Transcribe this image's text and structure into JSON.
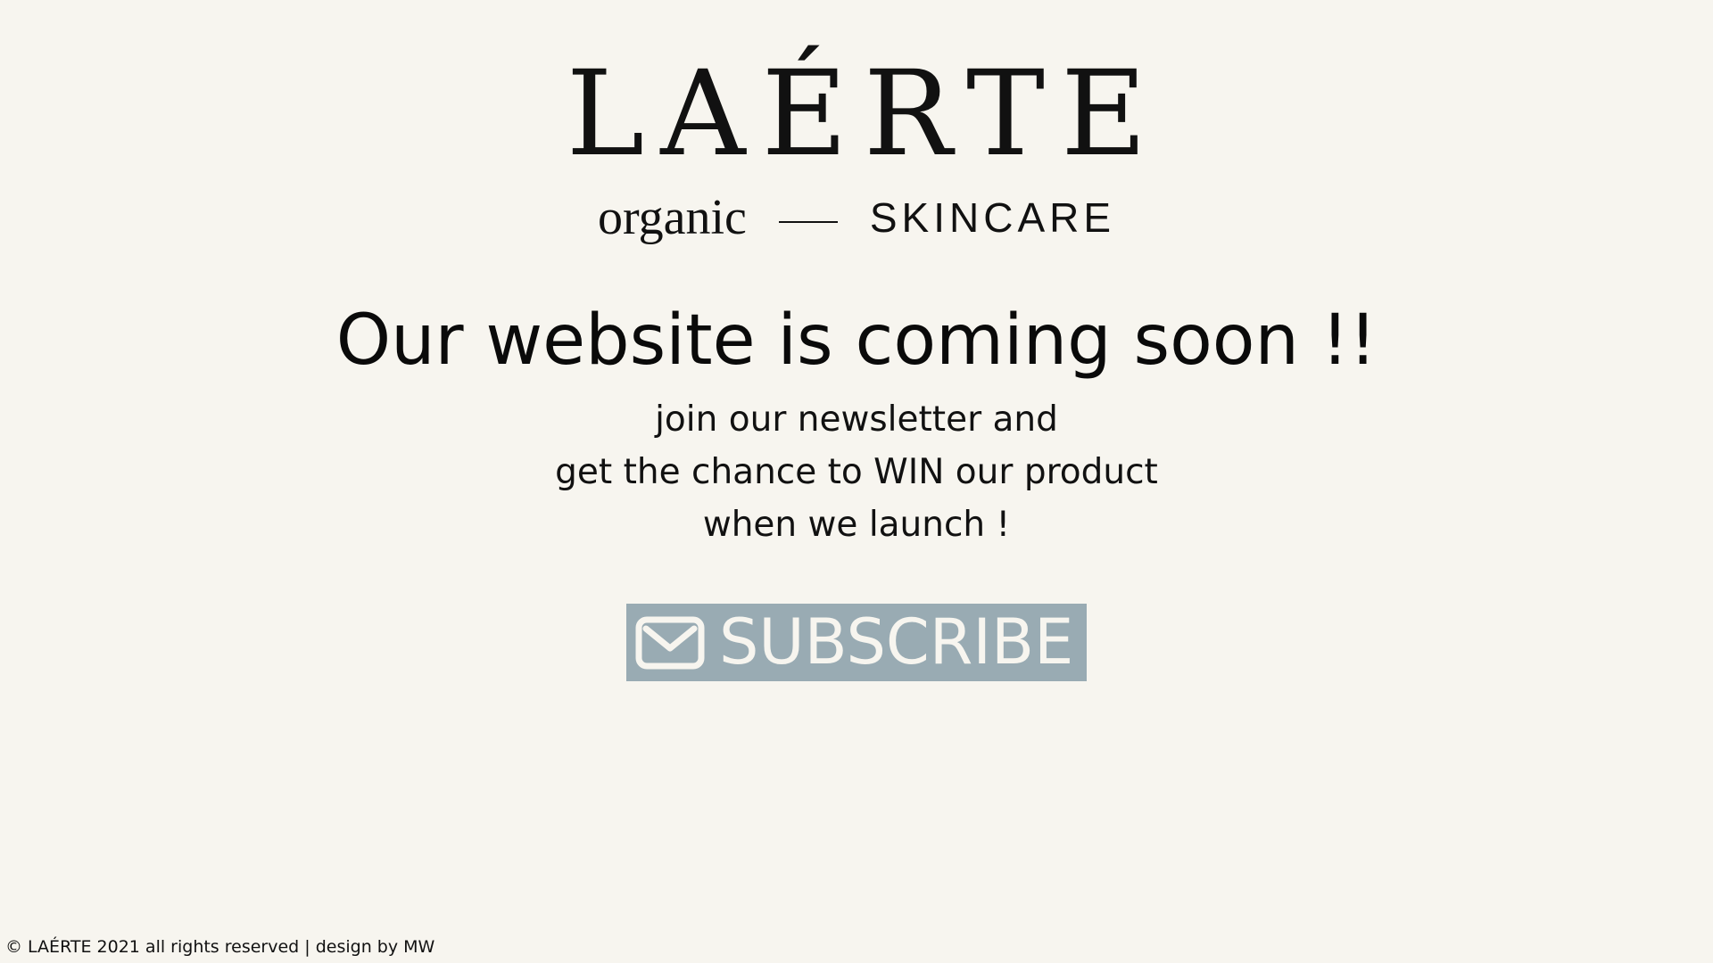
{
  "logo": {
    "wordmark": "LAÉRTE",
    "left_tagline": "organic",
    "right_tagline": "SKINCARE"
  },
  "headline": "Our website is coming soon !!",
  "message_lines": [
    "join our newsletter and",
    "get the chance to WIN our product",
    "when we launch !"
  ],
  "subscribe": {
    "label": "SUBSCRIBE",
    "icon": "envelope-icon",
    "background_color": "#99abb3",
    "text_color": "#f7f5ef"
  },
  "footer": "© LAÉRTE 2021 all rights reserved | design by MW",
  "colors": {
    "background": "#f7f5ef",
    "text": "#0c0c0c"
  }
}
